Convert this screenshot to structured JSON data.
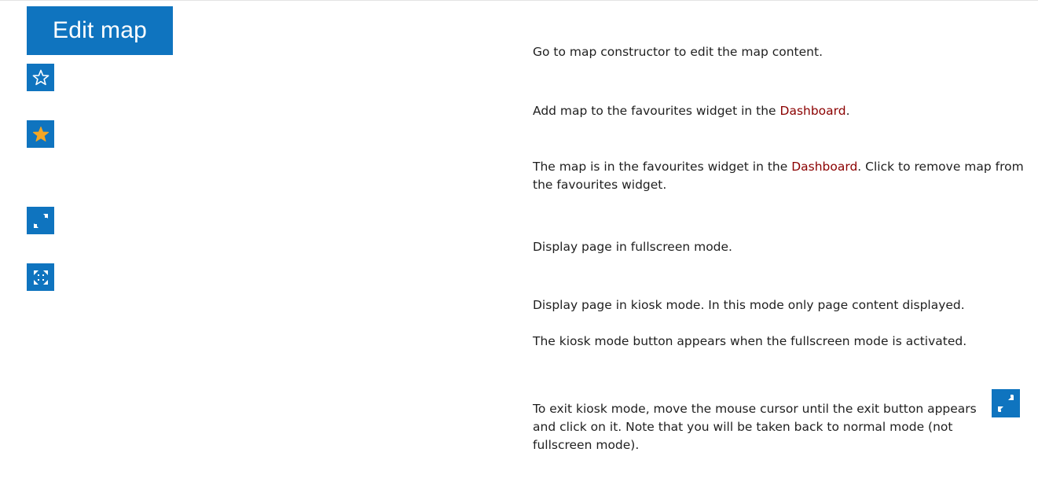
{
  "buttons": {
    "edit_map_label": "Edit map"
  },
  "icons": {
    "favourite_add": "star-outline-icon",
    "favourite_remove": "star-filled-icon",
    "fullscreen": "fullscreen-icon",
    "kiosk": "kiosk-mode-icon",
    "exit_kiosk": "exit-kiosk-icon"
  },
  "colors": {
    "button_bg": "#0f74bf",
    "link": "#8b0000",
    "star_filled": "#f5a623",
    "text": "#1f1f1f"
  },
  "descriptions": {
    "edit_map": "Go to map constructor to edit the map content.",
    "add_favourite": {
      "before": "Add map to the favourites widget in the ",
      "link": "Dashboard",
      "after": "."
    },
    "remove_favourite": {
      "before": "The map is in the favourites widget in the ",
      "link": "Dashboard",
      "after": ". Click to remove map from the favourites widget."
    },
    "fullscreen": "Display page in fullscreen mode.",
    "kiosk_line1": "Display page in kiosk mode. In this mode only page content displayed.",
    "kiosk_line2": "The kiosk mode button appears when the fullscreen mode is activated.",
    "kiosk_exit": "To exit kiosk mode, move the mouse cursor until the exit button appears and click on it. Note that you will be taken back to normal mode (not fullscreen mode)."
  }
}
